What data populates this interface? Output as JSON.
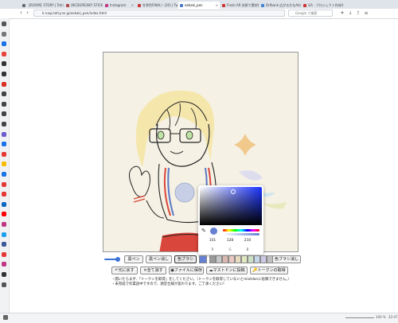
{
  "browser": {
    "tabs": [
      {
        "label": "【ROOM】STORY | Tetra",
        "color": "#6a6a6a"
      },
      {
        "label": "(NCDUPE)SKY STICK",
        "color": "#b04848"
      },
      {
        "label": "Instagram",
        "color": "#c13584"
      },
      {
        "label": "冬季色FINAL！(20) | Twe",
        "color": "#cc3333"
      },
      {
        "label": "oekaki_pen",
        "color": "#4a7bd0"
      },
      {
        "label": "Fresh AR 技術で素材制作",
        "color": "#cc3333"
      },
      {
        "label": "Drfbank 広がるかなAIの",
        "color": "#3d86d6"
      },
      {
        "label": "GA · プロジェクト作成中",
        "color": "#cc3333"
      }
    ],
    "url": "k-ruop.tetry.ne.jp/oekaki_pen/index.html",
    "search_placeholder": "Google で検索",
    "zoom": "100 %",
    "time": "22:07"
  },
  "sidebar_colors": [
    "#555",
    "#777",
    "#1a73e8",
    "#e8453c",
    "#333",
    "#333",
    "#d93025",
    "#444",
    "#444",
    "#444",
    "#444",
    "#6a5acd",
    "#1a73e8",
    "#e53935",
    "#fbbc04",
    "#1a73e8",
    "#e53935",
    "#e53935",
    "#0a66c2",
    "#ff0000",
    "#c13584",
    "#1da1f2",
    "#3b5998",
    "#e53935",
    "#c13584",
    "#333",
    "#555"
  ],
  "controls": {
    "black_pen": "黒ペン",
    "black_pen_erase": "黒ペン消し",
    "color_brush": "色ブラシ",
    "color_brush_erase": "色ブラシ消し",
    "undo": "元に戻す",
    "clear_all": "全て消す",
    "save_file": "ファイルに保存",
    "post_mastodon": "マストドンに投稿",
    "get_token": "トークンの取得",
    "selected_color": "#6580d2",
    "palette": [
      "#9a9a9a",
      "#c8c8c8",
      "#d9b8b0",
      "#e8c8c0",
      "#e8dcc0",
      "#e0e8c0",
      "#cbe0c6",
      "#c4d6e8",
      "#ccc8e6",
      "#c0c0c0"
    ]
  },
  "notes": [
    "・開いたらまず、「トークンを取得」をしてください。（トークンを取得していないとmixtdonに投稿できません。）",
    "・未完成で作業途中ですので、適宜仕様が変わります。ご了承ください！"
  ],
  "picker": {
    "r": "101",
    "g": "128",
    "b": "210",
    "r_label": "R",
    "g_label": "G",
    "b_label": "B",
    "color": "#6580d2"
  }
}
